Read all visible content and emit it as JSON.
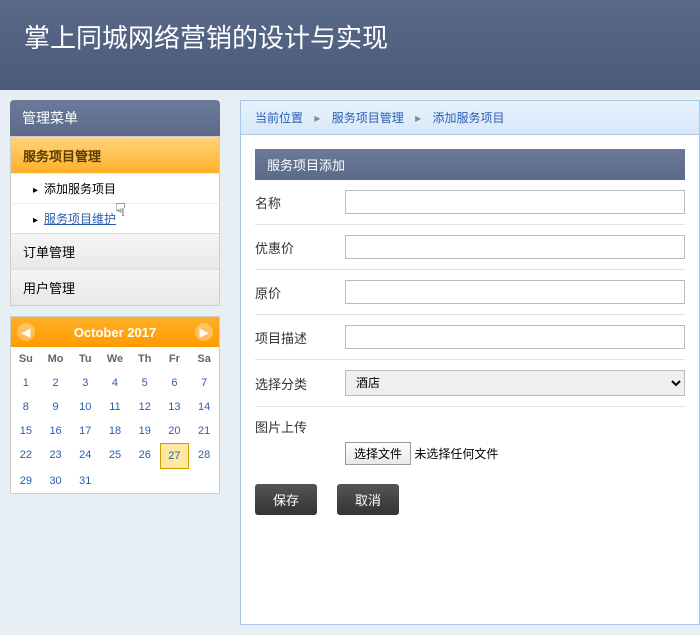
{
  "header": {
    "title": "掌上同城网络营销的设计与实现"
  },
  "sidebar": {
    "menu_title": "管理菜单",
    "items": [
      {
        "label": "服务项目管理",
        "active": true,
        "sub": [
          {
            "label": "添加服务项目"
          },
          {
            "label": "服务项目维护"
          }
        ]
      },
      {
        "label": "订单管理"
      },
      {
        "label": "用户管理"
      }
    ]
  },
  "calendar": {
    "title": "October 2017",
    "day_headers": [
      "Su",
      "Mo",
      "Tu",
      "We",
      "Th",
      "Fr",
      "Sa"
    ],
    "weeks": [
      [
        1,
        2,
        3,
        4,
        5,
        6,
        7
      ],
      [
        8,
        9,
        10,
        11,
        12,
        13,
        14
      ],
      [
        15,
        16,
        17,
        18,
        19,
        20,
        21
      ],
      [
        22,
        23,
        24,
        25,
        26,
        27,
        28
      ],
      [
        29,
        30,
        31,
        null,
        null,
        null,
        null
      ]
    ],
    "today": 27
  },
  "breadcrumb": {
    "label": "当前位置",
    "items": [
      "服务项目管理",
      "添加服务项目"
    ]
  },
  "form": {
    "section_title": "服务项目添加",
    "fields": {
      "name": "名称",
      "discount_price": "优惠价",
      "original_price": "原价",
      "project_desc": "项目描述",
      "category": "选择分类",
      "category_value": "酒店",
      "upload": "图片上传",
      "file_button": "选择文件",
      "file_status": "未选择任何文件"
    },
    "buttons": {
      "save": "保存",
      "cancel": "取消"
    }
  }
}
